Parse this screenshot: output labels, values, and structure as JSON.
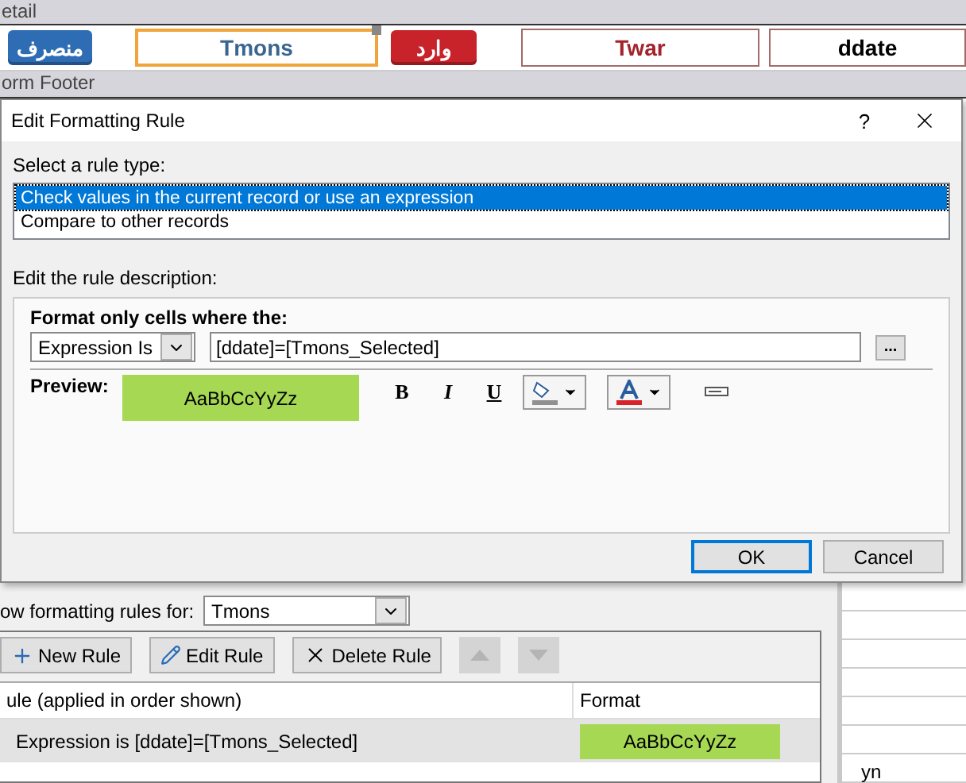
{
  "designer": {
    "detail_section": "etail",
    "footer_section": "orm Footer",
    "controls": [
      {
        "kind": "button",
        "label": "منصرف",
        "color": "#2e6db4"
      },
      {
        "kind": "field",
        "label": "Tmons",
        "color": "#3a6590",
        "selected": true
      },
      {
        "kind": "button",
        "label": "وارد",
        "color": "#c8222a"
      },
      {
        "kind": "field",
        "label": "Twar",
        "color": "#a3232b",
        "selected": false
      },
      {
        "kind": "field",
        "label": "ddate",
        "color": "#000000",
        "selected": false
      }
    ]
  },
  "manager": {
    "show_rules_label": "ow formatting rules for:",
    "show_rules_for": "Tmons",
    "toolbar": [
      {
        "kind": "new",
        "label": "New Rule"
      },
      {
        "kind": "edit",
        "label": "Edit Rule"
      },
      {
        "kind": "delete",
        "label": "Delete Rule"
      }
    ],
    "move_buttons": [
      {
        "kind": "up",
        "disabled": true
      },
      {
        "kind": "down",
        "disabled": true
      }
    ],
    "columns": [
      "ule (applied in order shown)",
      "Format"
    ],
    "rows": [
      {
        "rule": "Expression is [ddate]=[Tmons_Selected]",
        "format": "AaBbCcYyZz",
        "selected": true
      }
    ],
    "background_text": "yn"
  },
  "dialog": {
    "title": "Edit Formatting Rule",
    "help": "?",
    "rule_type_label": "Select a rule type:",
    "rule_types": [
      {
        "label": "Check values in the current record or use an expression",
        "selected": true
      },
      {
        "label": "Compare to other records",
        "selected": false
      }
    ],
    "description_label": "Edit the rule description:",
    "format_label": "Format only cells where the:",
    "condition": "Expression Is",
    "expression": "[ddate]=[Tmons_Selected]",
    "builder": "...",
    "preview_label": "Preview:",
    "preview_text": "AaBbCcYyZz",
    "style_buttons": [
      {
        "kind": "bold",
        "label": "B"
      },
      {
        "kind": "italic",
        "label": "I"
      },
      {
        "kind": "underline",
        "label": "U"
      }
    ],
    "buttons": [
      {
        "label": "OK",
        "default": true
      },
      {
        "label": "Cancel",
        "default": false
      }
    ]
  }
}
